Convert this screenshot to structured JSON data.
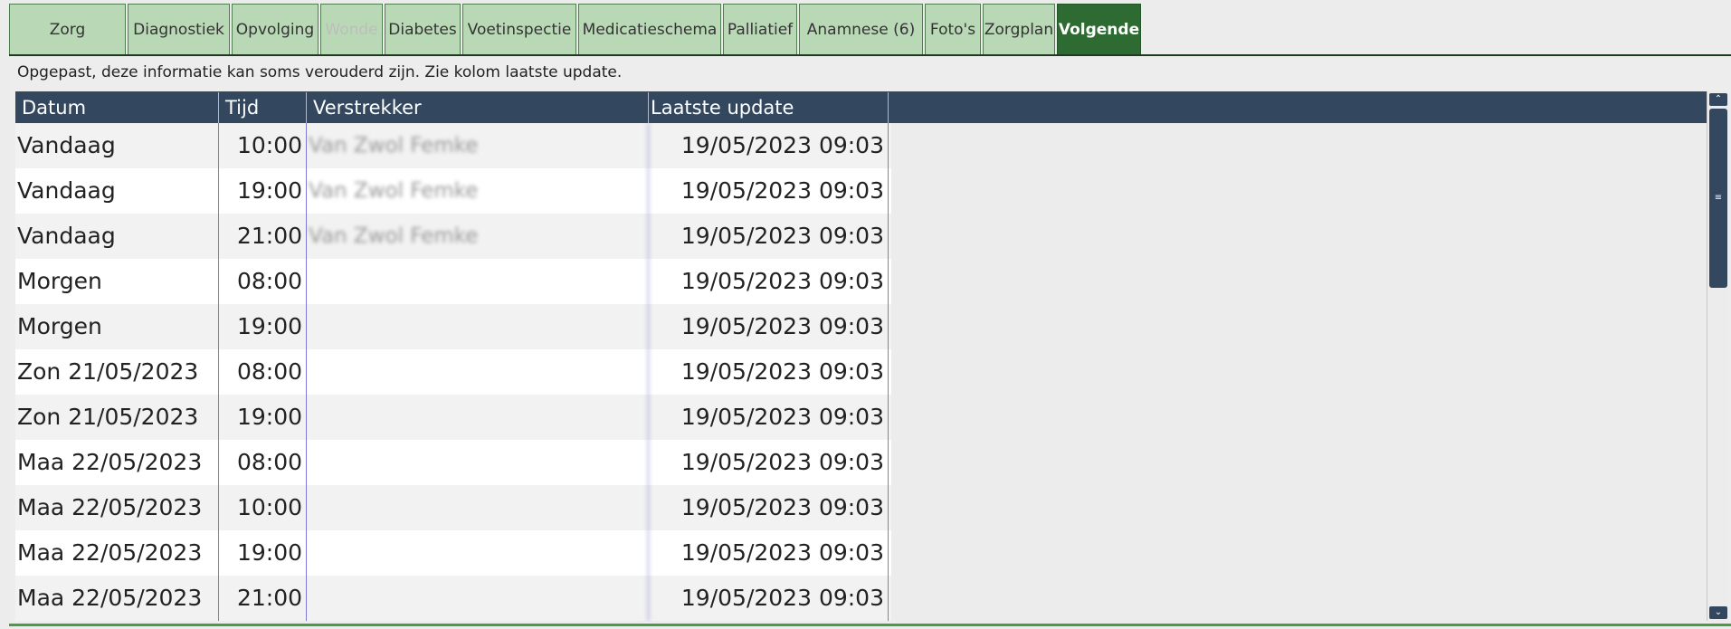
{
  "tabs": [
    {
      "label": "Zorg",
      "state": "normal"
    },
    {
      "label": "Diagnostiek",
      "state": "normal"
    },
    {
      "label": "Opvolging",
      "state": "normal"
    },
    {
      "label": "Wonde",
      "state": "disabled"
    },
    {
      "label": "Diabetes",
      "state": "normal"
    },
    {
      "label": "Voetinspectie",
      "state": "normal"
    },
    {
      "label": "Medicatieschema",
      "state": "normal"
    },
    {
      "label": "Palliatief",
      "state": "normal"
    },
    {
      "label": "Anamnese (6)",
      "state": "normal"
    },
    {
      "label": "Foto's",
      "state": "normal"
    },
    {
      "label": "Zorgplan",
      "state": "normal"
    },
    {
      "label": "Volgende",
      "state": "active"
    }
  ],
  "notice": "Opgepast, deze informatie kan soms verouderd zijn. Zie kolom laatste update.",
  "table": {
    "headers": {
      "datum": "Datum",
      "tijd": "Tijd",
      "verstrekker": "Verstrekker",
      "laatste_update": "Laatste update"
    },
    "rows": [
      {
        "datum": "Vandaag",
        "tijd": "10:00",
        "verstrekker": "Van Zwol Femke",
        "laatste_update": "19/05/2023 09:03"
      },
      {
        "datum": "Vandaag",
        "tijd": "19:00",
        "verstrekker": "Van Zwol Femke",
        "laatste_update": "19/05/2023 09:03"
      },
      {
        "datum": "Vandaag",
        "tijd": "21:00",
        "verstrekker": "Van Zwol Femke",
        "laatste_update": "19/05/2023 09:03"
      },
      {
        "datum": "Morgen",
        "tijd": "08:00",
        "verstrekker": "",
        "laatste_update": "19/05/2023 09:03"
      },
      {
        "datum": "Morgen",
        "tijd": "19:00",
        "verstrekker": "",
        "laatste_update": "19/05/2023 09:03"
      },
      {
        "datum": "Zon 21/05/2023",
        "tijd": "08:00",
        "verstrekker": "",
        "laatste_update": "19/05/2023 09:03"
      },
      {
        "datum": "Zon 21/05/2023",
        "tijd": "19:00",
        "verstrekker": "",
        "laatste_update": "19/05/2023 09:03"
      },
      {
        "datum": "Maa 22/05/2023",
        "tijd": "08:00",
        "verstrekker": "",
        "laatste_update": "19/05/2023 09:03"
      },
      {
        "datum": "Maa 22/05/2023",
        "tijd": "10:00",
        "verstrekker": "",
        "laatste_update": "19/05/2023 09:03"
      },
      {
        "datum": "Maa 22/05/2023",
        "tijd": "19:00",
        "verstrekker": "",
        "laatste_update": "19/05/2023 09:03"
      },
      {
        "datum": "Maa 22/05/2023",
        "tijd": "21:00",
        "verstrekker": "",
        "laatste_update": "19/05/2023 09:03"
      }
    ]
  },
  "scrollbar": {
    "up_icon": "chevron-up-icon",
    "down_icon": "chevron-down-icon",
    "thumb_icon": "grip-icon"
  },
  "colors": {
    "tab_bg": "#b9d9b6",
    "tab_active_bg": "#2e6b33",
    "header_bg": "#33475f",
    "row_alt_bg": "#f2f2f2",
    "column_divider": "#7a7cd6"
  }
}
